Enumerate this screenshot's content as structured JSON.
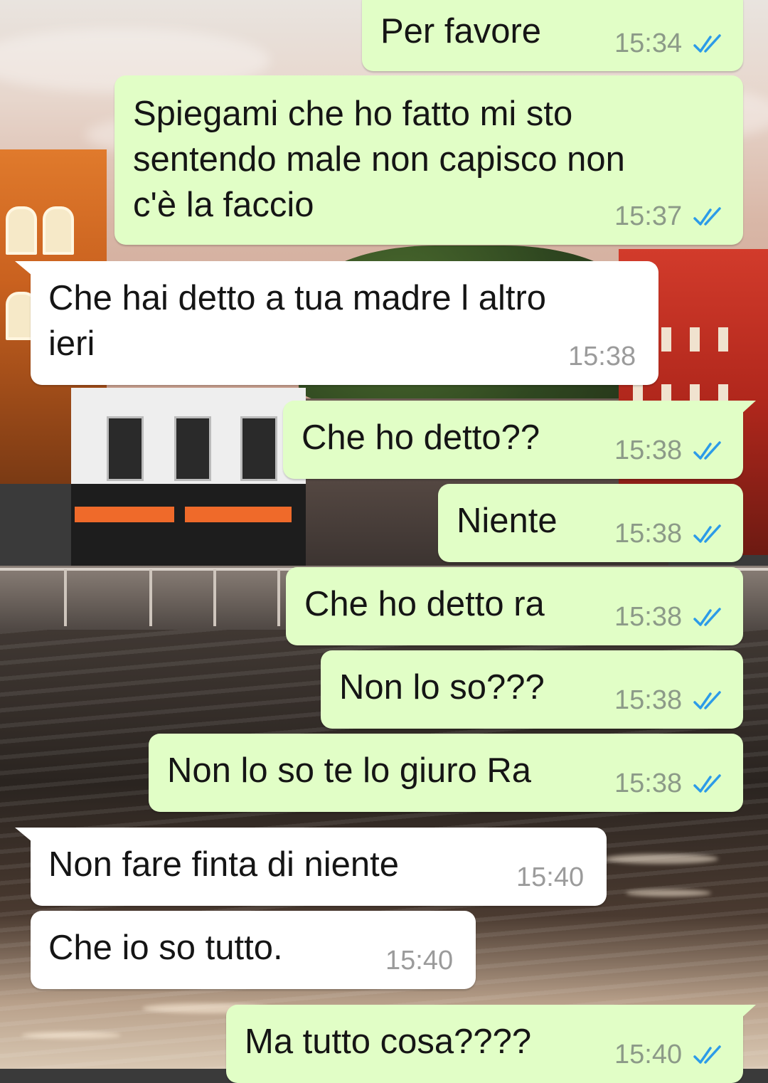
{
  "messages": [
    {
      "text": "Per favore",
      "time": "15:34",
      "direction": "outgoing",
      "status": "read"
    },
    {
      "text": "Spiegami che ho fatto mi sto\nsentendo male non capisco non\nc'è la faccio",
      "time": "15:37",
      "direction": "outgoing",
      "status": "read"
    },
    {
      "text": "Che hai detto a tua madre l altro\nieri",
      "time": "15:38",
      "direction": "incoming"
    },
    {
      "text": "Che ho detto??",
      "time": "15:38",
      "direction": "outgoing",
      "status": "read"
    },
    {
      "text": "Niente",
      "time": "15:38",
      "direction": "outgoing",
      "status": "read"
    },
    {
      "text": "Che ho detto ra",
      "time": "15:38",
      "direction": "outgoing",
      "status": "read"
    },
    {
      "text": "Non lo so???",
      "time": "15:38",
      "direction": "outgoing",
      "status": "read"
    },
    {
      "text": "Non lo so te lo giuro Ra",
      "time": "15:38",
      "direction": "outgoing",
      "status": "read"
    },
    {
      "text": "Non fare finta di niente",
      "time": "15:40",
      "direction": "incoming"
    },
    {
      "text": "Che io so tutto.",
      "time": "15:40",
      "direction": "incoming"
    },
    {
      "text": "Ma tutto cosa????",
      "time": "15:40",
      "direction": "outgoing",
      "status": "read"
    }
  ],
  "icons": {
    "read_receipt": "double-check-icon"
  },
  "colors": {
    "outgoing_bubble": "#e1fec6",
    "incoming_bubble": "#ffffff",
    "read_tick": "#2c9be8",
    "timestamp": "#8c9a88"
  }
}
